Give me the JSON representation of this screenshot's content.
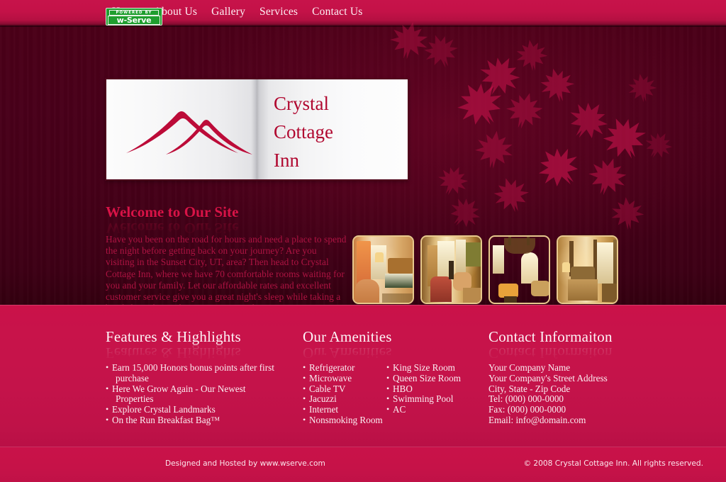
{
  "nav": {
    "items": [
      {
        "label": "Home"
      },
      {
        "label": "About Us"
      },
      {
        "label": "Gallery"
      },
      {
        "label": "Services"
      },
      {
        "label": "Contact Us"
      }
    ]
  },
  "logo": {
    "line1": "Crystal",
    "line2": "Cottage",
    "line3": "Inn",
    "mark_icon": "mountain-peaks-icon"
  },
  "welcome": {
    "heading": "Welcome to Our Site",
    "paragraph": "Have you been on the road for hours and need a place to spend the night before getting back on your journey? Are you visiting in the Sunset City, UT, area? Then head to Crystal Cottage Inn, where we have 70 comfortable rooms waiting for you and your family. Let our affordable rates and excellent customer service give you a great night's sleep while taking a break from the road! So stop at Crystal Cottage Inn, your home away from home!"
  },
  "gallery": {
    "thumbs": [
      {
        "alt": "guest-room-with-green-bedspread"
      },
      {
        "alt": "sitting-room-with-armchairs"
      },
      {
        "alt": "dining-hall-with-chandelier"
      },
      {
        "alt": "suite-with-four-poster-bed"
      }
    ]
  },
  "footer": {
    "features": {
      "heading": "Features & Highlights",
      "items": [
        {
          "text": "Earn 15,000 Honors bonus points after first",
          "cont": "purchase"
        },
        {
          "text": "Here We Grow Again - Our Newest",
          "cont": "Properties"
        },
        {
          "text": "Explore Crystal Landmarks",
          "cont": ""
        },
        {
          "text": "On the Run Breakfast Bag™",
          "cont": ""
        }
      ]
    },
    "amenities": {
      "heading": "Our Amenities",
      "col1": [
        {
          "text": "Refrigerator"
        },
        {
          "text": "Microwave"
        },
        {
          "text": "Cable TV"
        },
        {
          "text": "Jacuzzi"
        },
        {
          "text": "Internet"
        },
        {
          "text": "Nonsmoking Room"
        }
      ],
      "col2": [
        {
          "text": "King Size Room"
        },
        {
          "text": "Queen Size Room"
        },
        {
          "text": "HBO"
        },
        {
          "text": "Swimming Pool"
        },
        {
          "text": "AC"
        }
      ]
    },
    "contact": {
      "heading": "Contact Informaiton",
      "lines": [
        {
          "text": "Your Company Name"
        },
        {
          "text": "Your Company's Street Address"
        },
        {
          "text": "City, State - Zip Code"
        },
        {
          "text": "Tel: (000) 000-0000"
        },
        {
          "text": "Fax: (000) 000-0000"
        },
        {
          "text": "Email: info@domain.com"
        }
      ]
    }
  },
  "bottom": {
    "badge_top": "POWERED BY",
    "badge_main": "w-Serve",
    "credit": "Designed and Hosted by www.wserve.com",
    "copyright": "© 2008 Crystal Cottage Inn. All rights reserved."
  },
  "colors": {
    "crimson": "#c8134a",
    "dark_maroon": "#49001a",
    "logo_red": "#b0072f",
    "heading_pink": "#d81347",
    "body_red": "#ad1342",
    "footer_text": "#fbeef2",
    "badge_green": "#1f9e2e",
    "thumb_border": "#e8c98d"
  }
}
